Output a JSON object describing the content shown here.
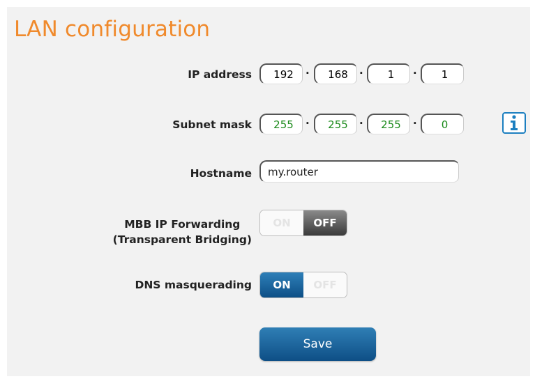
{
  "page": {
    "title": "LAN configuration"
  },
  "ip_address": {
    "label": "IP address",
    "octets": [
      "192",
      "168",
      "1",
      "1"
    ]
  },
  "subnet_mask": {
    "label": "Subnet mask",
    "octets": [
      "255",
      "255",
      "255",
      "0"
    ]
  },
  "hostname": {
    "label": "Hostname",
    "value": "my.router"
  },
  "mbb_forwarding": {
    "label_line1": "MBB IP Forwarding",
    "label_line2": "(Transparent Bridging)",
    "on_label": "ON",
    "off_label": "OFF",
    "state": "OFF"
  },
  "dns_masquerading": {
    "label": "DNS masquerading",
    "on_label": "ON",
    "off_label": "OFF",
    "state": "ON"
  },
  "save_label": "Save",
  "colors": {
    "title": "#f08a2c",
    "accent": "#0e4f86",
    "mask_text": "#1a8a1a"
  },
  "icons": {
    "info": "info-icon"
  }
}
